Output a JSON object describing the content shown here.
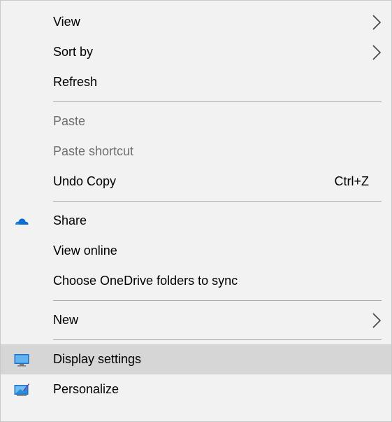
{
  "menu": {
    "view": "View",
    "sort_by": "Sort by",
    "refresh": "Refresh",
    "paste": "Paste",
    "paste_shortcut": "Paste shortcut",
    "undo_copy": "Undo Copy",
    "undo_copy_shortcut": "Ctrl+Z",
    "share": "Share",
    "view_online": "View online",
    "choose_onedrive": "Choose OneDrive folders to sync",
    "new": "New",
    "display_settings": "Display settings",
    "personalize": "Personalize"
  },
  "icons": {
    "share": "onedrive-cloud-icon",
    "display_settings": "monitor-icon",
    "personalize": "personalize-icon",
    "submenu": "chevron-right-icon"
  },
  "colors": {
    "menu_background": "#f2f2f2",
    "highlight": "#d6d6d6",
    "disabled_text": "#6f6f6f",
    "onedrive_blue": "#0a6fd1"
  }
}
